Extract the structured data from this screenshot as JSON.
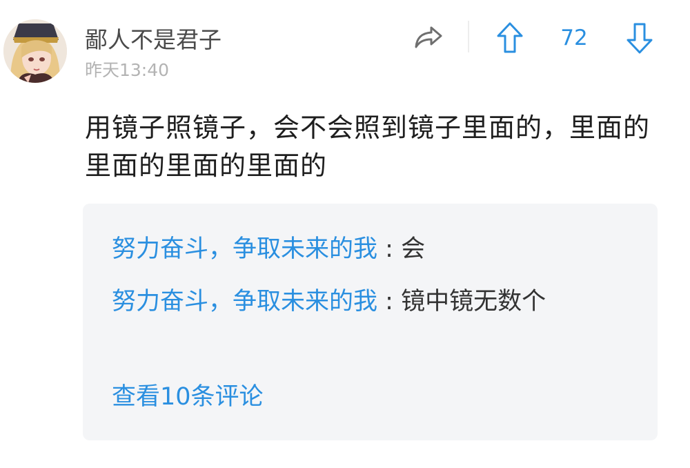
{
  "post": {
    "user": {
      "name": "鄙人不是君子",
      "avatar_icon": "anime-girl-avatar"
    },
    "time": "昨天13:40",
    "actions": {
      "share_icon": "share-icon",
      "upvote_icon": "upvote-arrow-icon",
      "vote_count": "72",
      "downvote_icon": "downvote-arrow-icon"
    },
    "content": "用镜子照镜子，会不会照到镜子里面的，里面的里面的里面的里面的"
  },
  "comments": {
    "items": [
      {
        "author": "努力奋斗，争取未来的我",
        "separator": ":",
        "text": "会"
      },
      {
        "author": "努力奋斗，争取未来的我",
        "separator": ":",
        "text": "镜中镜无数个"
      }
    ],
    "view_all_label": "查看10条评论"
  },
  "colors": {
    "accent": "#2a8fe0",
    "username": "#4a4a4a",
    "timestamp": "#b3b3b3",
    "comments_background": "#f4f5f7"
  }
}
